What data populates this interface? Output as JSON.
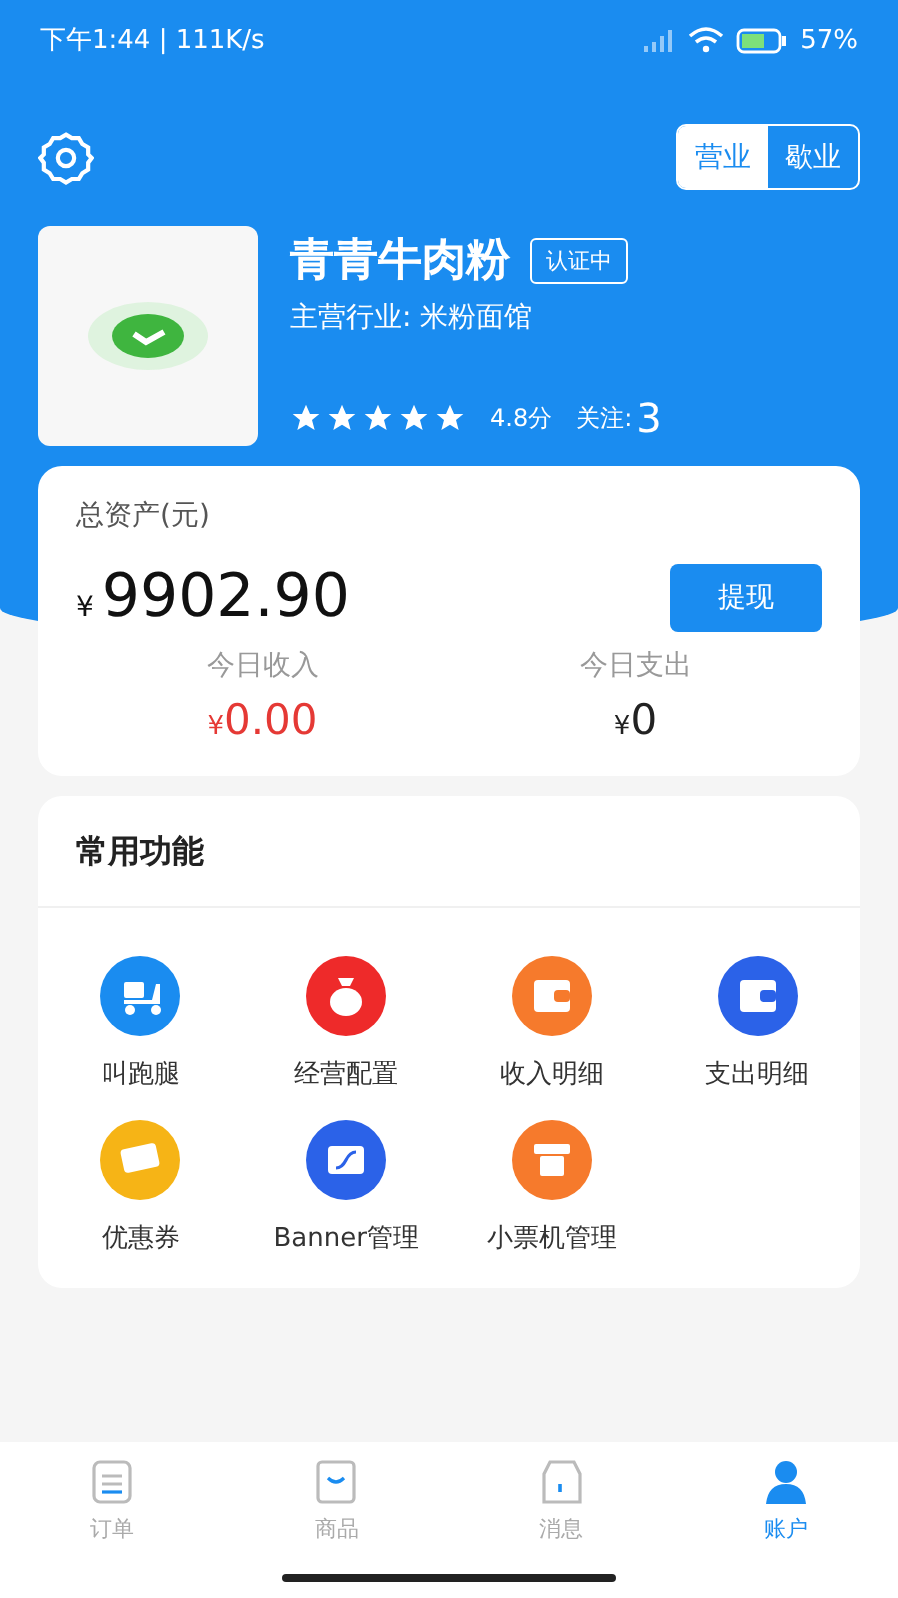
{
  "status_bar": {
    "time": "下午1:44 | 111K/s",
    "battery": "57%"
  },
  "mode_toggle": [
    {
      "label": "营业",
      "selected": true
    },
    {
      "label": "歇业",
      "selected": false
    }
  ],
  "store": {
    "name": "青青牛肉粉",
    "badge": "认证中",
    "industry": "主营行业: 米粉面馆",
    "stars": 5,
    "score": "4.8分",
    "follow_label": "关注:",
    "follow_count": "3"
  },
  "assets": {
    "title": "总资产(元)",
    "currency": "¥",
    "amount": "9902.90",
    "withdraw": "提现",
    "stats": [
      {
        "label": "今日收入",
        "currency": "¥",
        "value": "0.00",
        "kind": "income"
      },
      {
        "label": "今日支出",
        "currency": "¥",
        "value": "0",
        "kind": "expense"
      }
    ]
  },
  "functions": {
    "title": "常用功能",
    "items": [
      {
        "label": "叫跑腿",
        "kind": "scooter",
        "color": "#1a8cf0"
      },
      {
        "label": "经营配置",
        "kind": "moneybag",
        "color": "#ee2a2a"
      },
      {
        "label": "收入明细",
        "kind": "wallet-in",
        "color": "#f67a2c"
      },
      {
        "label": "支出明细",
        "kind": "wallet-out",
        "color": "#2b62e8"
      },
      {
        "label": "优惠券",
        "kind": "ticket",
        "color": "#f6b416"
      },
      {
        "label": "Banner管理",
        "kind": "banner",
        "color": "#2b62e8"
      },
      {
        "label": "小票机管理",
        "kind": "printer",
        "color": "#f67a2c"
      }
    ]
  },
  "nav": [
    {
      "label": "订单",
      "kind": "orders",
      "selected": false
    },
    {
      "label": "商品",
      "kind": "goods",
      "selected": false
    },
    {
      "label": "消息",
      "kind": "store",
      "selected": false
    },
    {
      "label": "账户",
      "kind": "account",
      "selected": true
    }
  ]
}
